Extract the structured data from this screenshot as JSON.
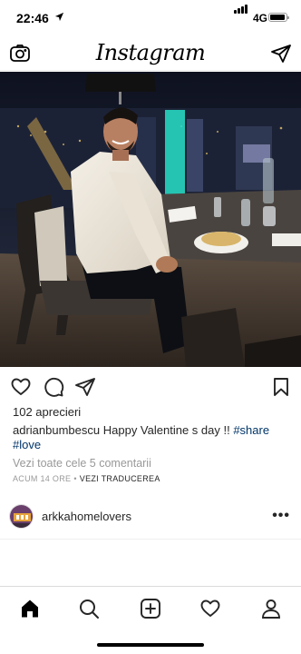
{
  "status_bar": {
    "time": "22:46",
    "network": "4G"
  },
  "header": {
    "logo": "Instagram",
    "left_icon": "camera-icon",
    "right_icon": "direct-send-icon"
  },
  "post": {
    "likes_text": "102 aprecieri",
    "caption": {
      "username": "adrianbumbescu",
      "text": " Happy Valentine s day !! ",
      "hashtag1": "#share",
      "hashtag2": "#love"
    },
    "view_comments": "Vezi toate cele 5 comentarii",
    "timestamp": "ACUM 14 ORE",
    "separator": "•",
    "translate": "VEZI TRADUCEREA"
  },
  "suggested": {
    "username": "arkkahomelovers",
    "more_icon": "ellipsis-icon",
    "more_label": "•••"
  },
  "bottom_nav": {
    "items": [
      "home-icon",
      "search-icon",
      "add-post-icon",
      "activity-heart-icon",
      "profile-icon"
    ]
  },
  "colors": {
    "text": "#262626",
    "muted": "#999999",
    "hashtag": "#003569",
    "divider": "#dbdbdb"
  }
}
